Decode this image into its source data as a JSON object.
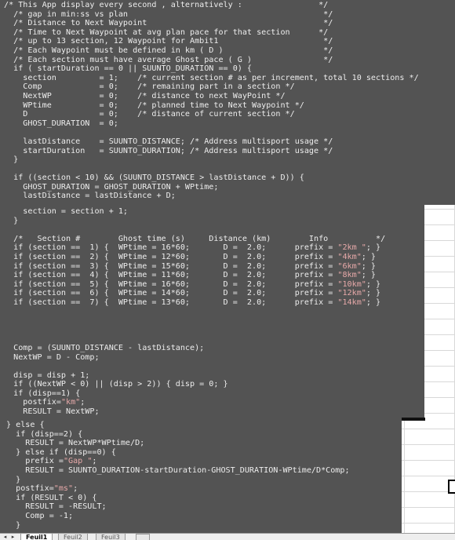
{
  "code_top": [
    "/* This App display every second , alternatively :                */",
    "  /* gap in min:ss vs plan                                         */",
    "  /* Distance to Next Waypoint                                     */",
    "  /* Time to Next Waypoint at avg plan pace for that section      */",
    "  /* up to 13 section, 12 Waypoint for Ambit1                      */",
    "  /* Each Waypoint must be defined in km ( D )                     */",
    "  /* Each section must have average Ghost pace ( G )               */",
    "  if ( startDuration == 0 || SUUNTO_DURATION == 0) {",
    "    section         = 1;    /* current section # as per increment, total 10 sections */",
    "    Comp            = 0;    /* remaining part in a section */",
    "    NextWP          = 0;    /* distance to next WayPoint */",
    "    WPtime          = 0;    /* planned time to Next Waypoint */",
    "    D               = 0;    /* distance of current section */",
    "    GHOST_DURATION  = 0;",
    "",
    "    lastDistance    = SUUNTO_DISTANCE; /* Address multisport usage */",
    "    startDuration   = SUUNTO_DURATION; /* Address multisport usage */",
    "  }",
    "",
    "  if ((section < 10) && (SUUNTO_DISTANCE > lastDistance + D)) {",
    "    GHOST_DURATION = GHOST_DURATION + WPtime;",
    "    lastDistance = lastDistance + D;"
  ],
  "code_mid": [
    "    section = section + 1;",
    "  }",
    "",
    "  /*   Section #        Ghost time (s)     Distance (km)        Info          */",
    "  if (section ==  1) {  WPtime = 16*60;       D =  2.0;      prefix = \"2km \"; }",
    "  if (section ==  2) {  WPtime = 12*60;       D =  2.0;      prefix = \"4km\"; }",
    "  if (section ==  3) {  WPtime = 15*60;       D =  2.0;      prefix = \"6km\"; }",
    "  if (section ==  4) {  WPtime = 11*60;       D =  2.0;      prefix = \"8km\"; }",
    "  if (section ==  5) {  WPtime = 16*60;       D =  2.0;      prefix = \"10km\"; }",
    "  if (section ==  6) {  WPtime = 14*60;       D =  2.0;      prefix = \"12km\"; }",
    "  if (section ==  7) {  WPtime = 13*60;       D =  2.0;      prefix = \"14km\"; }",
    "",
    "",
    "",
    "",
    "  Comp = (SUUNTO_DISTANCE - lastDistance);",
    "  NextWP = D - Comp;",
    "",
    "  disp = disp + 1;",
    "  if ((NextWP < 0) || (disp > 2)) { disp = 0; }",
    "  if (disp==1) {",
    "    postfix=\"km\";",
    "    RESULT = NextWP;"
  ],
  "code_bot": [
    "} else {",
    "  if (disp==2) {",
    "    RESULT = NextWP*WPtime/D;",
    "  } else if (disp==0) {",
    "    prefix =\"Gap \";",
    "    RESULT = SUUNTO_DURATION-startDuration-GHOST_DURATION-WPtime/D*Comp;",
    "  }",
    "  postfix=\"ms\";",
    "  if (RESULT < 0) {",
    "    RESULT = -RESULT;",
    "    Comp = -1;",
    "  }"
  ],
  "tabs": {
    "nav_first": "◂",
    "nav_last": "▸",
    "sheets": [
      "Feuil1",
      "Feuil2",
      "Feuil3"
    ],
    "add_icon": "sheet-add-icon"
  },
  "colors": {
    "editor_bg": "#535353",
    "code_text": "#ededed",
    "string_text": "#e7a9a9",
    "sheet_grid": "#d8d8d8"
  }
}
